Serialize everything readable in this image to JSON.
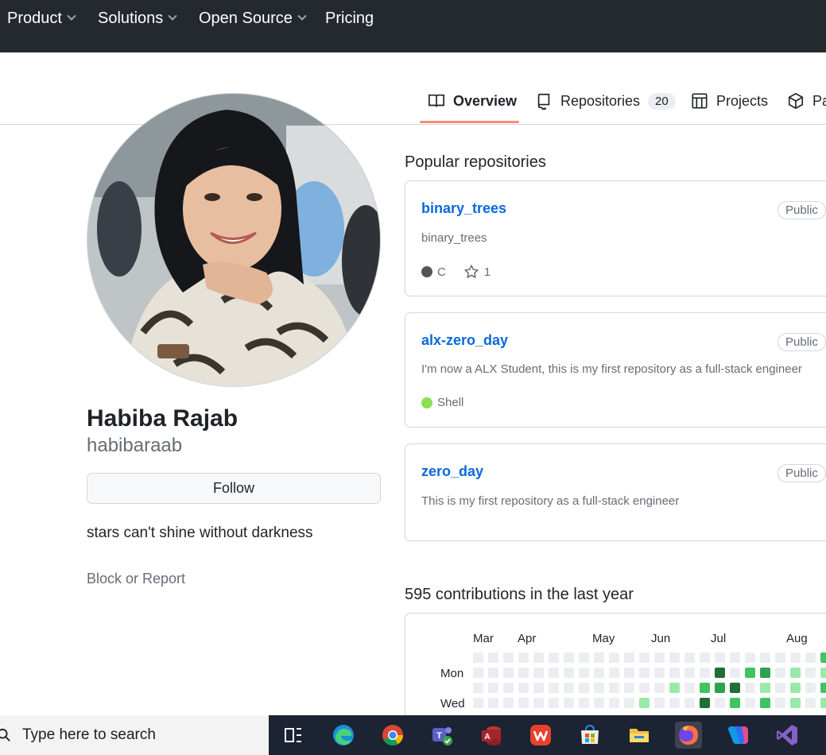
{
  "topnav": {
    "items": [
      {
        "label": "Product",
        "dropdown": true
      },
      {
        "label": "Solutions",
        "dropdown": true
      },
      {
        "label": "Open Source",
        "dropdown": true
      },
      {
        "label": "Pricing",
        "dropdown": false
      }
    ]
  },
  "tabs": {
    "overview": "Overview",
    "repositories": "Repositories",
    "repositories_count": "20",
    "projects": "Projects",
    "packages": "Pa"
  },
  "profile": {
    "name": "Habiba Rajab",
    "login": "habibaraab",
    "follow_label": "Follow",
    "bio": "stars can't shine without darkness",
    "block_label": "Block or Report"
  },
  "popular": {
    "title": "Popular repositories",
    "repos": [
      {
        "name": "binary_trees",
        "visibility": "Public",
        "description": "binary_trees",
        "language": "C",
        "language_color": "#555555",
        "stars": "1"
      },
      {
        "name": "alx-zero_day",
        "visibility": "Public",
        "description": "I'm now a ALX Student, this is my first repository as a full-stack engineer",
        "language": "Shell",
        "language_color": "#89e051"
      },
      {
        "name": "zero_day",
        "visibility": "Public",
        "description": "This is my first repository as a full-stack engineer"
      }
    ]
  },
  "contributions": {
    "title": "595 contributions in the last year",
    "months": [
      "Mar",
      "Apr",
      "May",
      "Jun",
      "Jul",
      "Aug"
    ],
    "days": [
      "Mon",
      "Wed"
    ],
    "levels": [
      [
        0,
        0,
        0,
        0,
        0,
        0,
        0,
        0,
        0,
        0,
        0,
        0,
        0,
        0,
        0,
        0,
        0,
        0,
        0,
        0,
        0,
        0,
        0,
        2
      ],
      [
        0,
        0,
        0,
        0,
        0,
        0,
        0,
        0,
        0,
        0,
        0,
        0,
        0,
        0,
        0,
        0,
        4,
        0,
        2,
        3,
        0,
        1,
        0,
        1
      ],
      [
        0,
        0,
        0,
        0,
        0,
        0,
        0,
        0,
        0,
        0,
        0,
        0,
        0,
        1,
        0,
        2,
        3,
        4,
        0,
        1,
        0,
        1,
        0,
        2
      ],
      [
        0,
        0,
        0,
        0,
        0,
        0,
        0,
        0,
        0,
        0,
        0,
        1,
        0,
        0,
        0,
        4,
        0,
        2,
        0,
        2,
        0,
        1,
        0,
        1
      ]
    ],
    "colors": [
      "#ebedf0",
      "#9be9a8",
      "#40c463",
      "#30a14e",
      "#216e39"
    ]
  },
  "taskbar": {
    "search_placeholder": "Type here to search",
    "apps": [
      "task-view",
      "edge",
      "chrome",
      "teams",
      "access",
      "wps-office",
      "microsoft-store",
      "file-explorer",
      "firefox",
      "copilot",
      "visual-studio"
    ]
  }
}
